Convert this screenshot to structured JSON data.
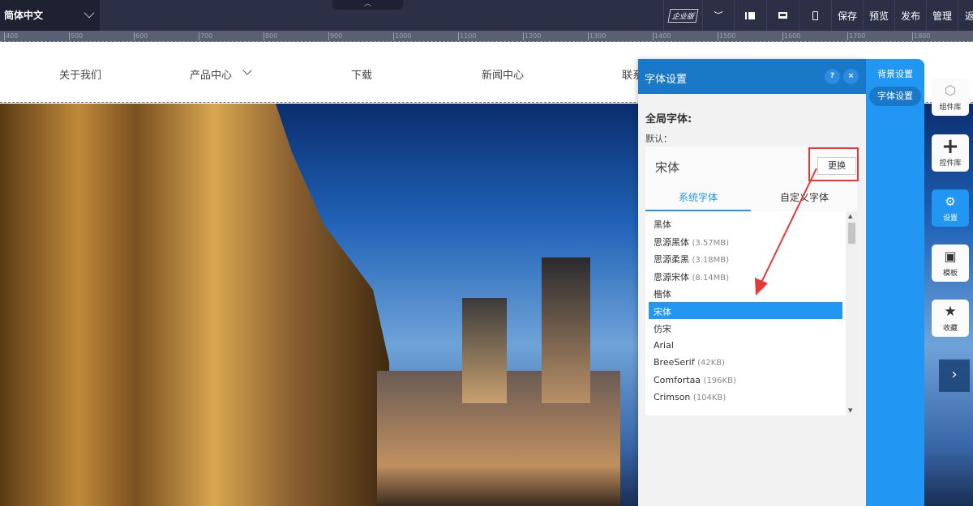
{
  "topbar": {
    "language": "简体中文",
    "edition_badge": "企业版",
    "save": "保存",
    "preview": "预览",
    "publish": "发布",
    "manage": "管理",
    "back": "返"
  },
  "ruler": [
    "400",
    "500",
    "600",
    "700",
    "800",
    "900",
    "1000",
    "1100",
    "1200",
    "1300",
    "1400",
    "1500",
    "1600",
    "1700",
    "1800"
  ],
  "nav": {
    "items": [
      "关于我们",
      "产品中心",
      "下载",
      "新闻中心",
      "联系"
    ]
  },
  "panel": {
    "title": "字体设置",
    "help": "?",
    "close": "×",
    "global_font": "全局字体:",
    "default_label": "默认：",
    "current_font": "宋体",
    "change_button": "更换",
    "tabs": [
      "系统字体",
      "自定义字体"
    ],
    "fonts": [
      {
        "name": "黑体",
        "size": ""
      },
      {
        "name": "思源黑体",
        "size": "(3.57MB)"
      },
      {
        "name": "思源柔黑",
        "size": "(3.18MB)"
      },
      {
        "name": "思源宋体",
        "size": "(8.14MB)"
      },
      {
        "name": "楷体",
        "size": ""
      },
      {
        "name": "宋体",
        "size": ""
      },
      {
        "name": "仿宋",
        "size": ""
      },
      {
        "name": "Arial",
        "size": ""
      },
      {
        "name": "BreeSerif",
        "size": "(42KB)"
      },
      {
        "name": "Comfortaa",
        "size": "(196KB)"
      },
      {
        "name": "Crimson",
        "size": "(104KB)"
      }
    ],
    "selected_font": "宋体"
  },
  "side_tabs": [
    "背景设置",
    "字体设置"
  ],
  "tools": [
    {
      "label": "组件库",
      "icon": "cube-icon"
    },
    {
      "label": "控件库",
      "icon": "plus-icon"
    },
    {
      "label": "设置",
      "icon": "gears-icon"
    },
    {
      "label": "模板",
      "icon": "template-icon"
    },
    {
      "label": "收藏",
      "icon": "star-icon"
    }
  ],
  "colors": {
    "accent": "#2196f3",
    "header": "#1a78c8",
    "highlight": "#e53935"
  }
}
